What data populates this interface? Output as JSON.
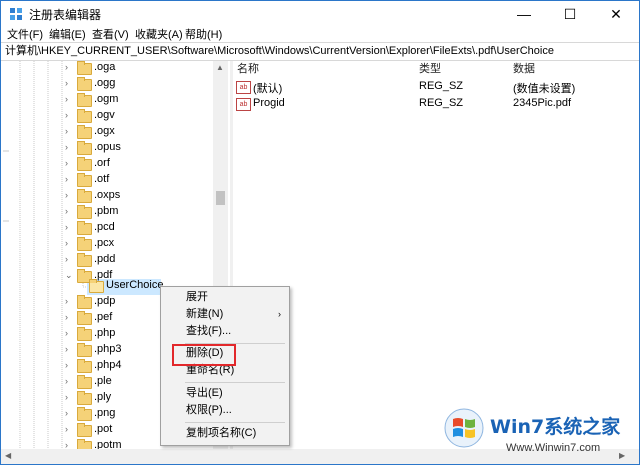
{
  "window": {
    "title": "注册表编辑器",
    "minimize_glyph": "—",
    "maximize_glyph": "☐",
    "close_glyph": "✕"
  },
  "menu": [
    "文件(F)",
    "编辑(E)",
    "查看(V)",
    "收藏夹(A)",
    "帮助(H)"
  ],
  "address": "计算机\\HKEY_CURRENT_USER\\Software\\Microsoft\\Windows\\CurrentVersion\\Explorer\\FileExts\\.pdf\\UserChoice",
  "tree": {
    "items": [
      ".oga",
      ".ogg",
      ".ogm",
      ".ogv",
      ".ogx",
      ".opus",
      ".orf",
      ".otf",
      ".oxps",
      ".pbm",
      ".pcd",
      ".pcx",
      ".pdd",
      ".pdf",
      ".pdp",
      ".pef",
      ".php",
      ".php3",
      ".php4",
      ".ple",
      ".ply",
      ".png",
      ".pot",
      ".potm"
    ],
    "expanded_child": "UserChoice",
    "collapsed_arrow": "›",
    "expanded_arrow": "⌄"
  },
  "values_pane": {
    "columns": [
      "名称",
      "类型",
      "数据"
    ],
    "rows": [
      {
        "icon": "string-value-icon",
        "name": "(默认)",
        "type": "REG_SZ",
        "data": "(数值未设置)"
      },
      {
        "icon": "string-value-icon",
        "name": "Progid",
        "type": "REG_SZ",
        "data": "2345Pic.pdf"
      }
    ]
  },
  "context_menu": {
    "items": [
      "展开",
      "新建(N)",
      "查找(F)...",
      "删除(D)",
      "重命名(R)",
      "导出(E)",
      "权限(P)...",
      "复制项名称(C)"
    ],
    "submenu_arrow": "›",
    "highlighted": "删除(D)"
  },
  "colors": {
    "accent": "#2b76c9",
    "selection": "#cce8ff",
    "highlight_box": "#e2282b",
    "folder": "#f5d278"
  },
  "watermark": {
    "brand": "Win7系统之家",
    "url": "Www.Winwin7.com"
  }
}
